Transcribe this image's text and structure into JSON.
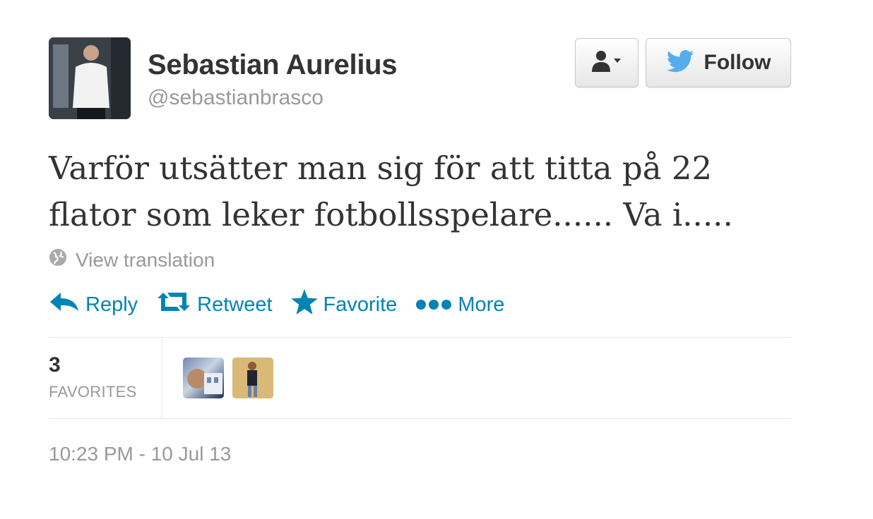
{
  "user": {
    "name": "Sebastian Aurelius",
    "handle": "@sebastianbrasco",
    "avatar_icon": "profile-photo"
  },
  "buttons": {
    "user_menu_icon": "person-dropdown-icon",
    "follow_label": "Follow",
    "follow_icon": "twitter-bird-icon"
  },
  "tweet": {
    "text_line1": "Varför utsätter man sig för att titta på 22",
    "text_line2": "flator som leker fotbollsspelare...... Va i.....",
    "translate_label": "View translation"
  },
  "actions": [
    {
      "label": "Reply",
      "icon": "reply-icon"
    },
    {
      "label": "Retweet",
      "icon": "retweet-icon"
    },
    {
      "label": "Favorite",
      "icon": "star-icon"
    },
    {
      "label": "More",
      "icon": "more-dots-icon"
    }
  ],
  "stats": {
    "favorites_count": "3",
    "favorites_label": "FAVORITES"
  },
  "timestamp": "10:23 PM - 10 Jul 13",
  "colors": {
    "link": "#0084b4",
    "muted": "#999999",
    "text": "#333333",
    "twitter_blue": "#55acee"
  }
}
